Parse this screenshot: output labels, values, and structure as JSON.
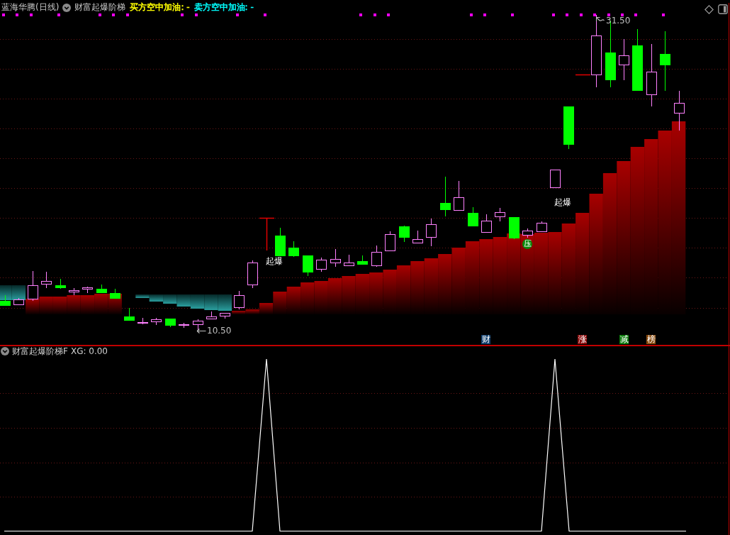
{
  "header": {
    "symbol": "蓝海华腾(日线)",
    "indicator": "财富起爆阶梯",
    "readouts": [
      {
        "text": "买方空中加油: -",
        "color": "#ffff00"
      },
      {
        "text": "卖方空中加油: -",
        "color": "#00ffff"
      }
    ]
  },
  "main_chart": {
    "high_label": "31.50",
    "low_label": "10.50",
    "signals": [
      {
        "label": "起爆"
      },
      {
        "label": "起爆"
      }
    ],
    "pressure_badge": "压",
    "event_tags": [
      {
        "label": "财",
        "color": "#12406e"
      },
      {
        "label": "涨",
        "color": "#8a0c0c"
      },
      {
        "label": "减",
        "color": "#0c7a0c"
      },
      {
        "label": "榜",
        "color": "#8a4c10"
      }
    ]
  },
  "sub_chart": {
    "indicator": "财富起爆阶梯F",
    "readout": "XG: 0.00"
  }
}
